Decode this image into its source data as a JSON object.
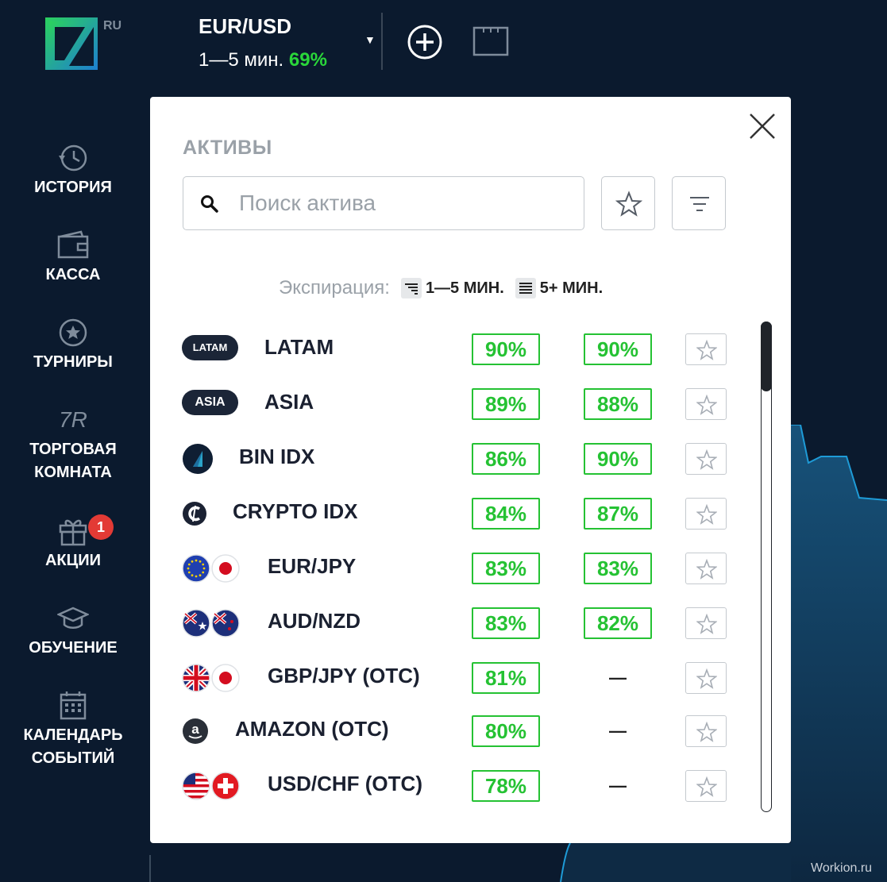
{
  "header": {
    "logo_suffix": "RU",
    "asset": {
      "name": "EUR/USD",
      "duration": "1—5 мин.",
      "payout": "69%"
    }
  },
  "sidebar": {
    "items": [
      {
        "label": "ИСТОРИЯ",
        "icon": "history-icon"
      },
      {
        "label": "КАССА",
        "icon": "wallet-icon"
      },
      {
        "label": "ТУРНИРЫ",
        "icon": "star-circle-icon"
      },
      {
        "label_line1": "ТОРГОВАЯ",
        "label_line2": "КОМНАТА",
        "icon": "trading-room-icon",
        "icon_text": "7R"
      },
      {
        "label": "АКЦИИ",
        "icon": "gift-icon",
        "badge": "1"
      },
      {
        "label": "ОБУЧЕНИЕ",
        "icon": "graduation-cap-icon"
      },
      {
        "label_line1": "КАЛЕНДАРЬ",
        "label_line2": "СОБЫТИЙ",
        "icon": "calendar-icon"
      }
    ]
  },
  "modal": {
    "title": "АКТИВЫ",
    "search_placeholder": "Поиск актива",
    "expiry_label": "Экспирация:",
    "expiry_short": "1—5 МИН.",
    "expiry_long": "5+ МИН.",
    "assets": [
      {
        "name": "LATAM",
        "icon": "latam-pill",
        "icon_text": "LATAM",
        "short": "90%",
        "long": "90%"
      },
      {
        "name": "ASIA",
        "icon": "asia-pill",
        "icon_text": "ASIA",
        "short": "89%",
        "long": "88%"
      },
      {
        "name": "BIN IDX",
        "icon": "bin-idx-icon",
        "short": "86%",
        "long": "90%"
      },
      {
        "name": "CRYPTO IDX",
        "icon": "crypto-idx-icon",
        "short": "84%",
        "long": "87%"
      },
      {
        "name": "EUR/JPY",
        "icon": "eu-jp-flags-icon",
        "short": "83%",
        "long": "83%"
      },
      {
        "name": "AUD/NZD",
        "icon": "au-nz-flags-icon",
        "short": "83%",
        "long": "82%"
      },
      {
        "name": "GBP/JPY (OTC)",
        "icon": "gb-jp-flags-icon",
        "short": "81%",
        "long": "—"
      },
      {
        "name": "AMAZON (OTC)",
        "icon": "amazon-icon",
        "short": "80%",
        "long": "—"
      },
      {
        "name": "USD/CHF (OTC)",
        "icon": "us-ch-flags-icon",
        "short": "78%",
        "long": "—"
      }
    ]
  },
  "watermark": "Workion.ru",
  "colors": {
    "background": "#0b1a2e",
    "accent_green": "#25c233",
    "badge_red": "#e33a35",
    "chart_line": "#1e9bd7"
  }
}
